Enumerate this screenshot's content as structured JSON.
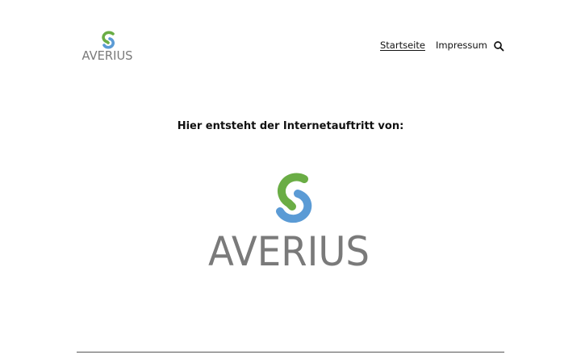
{
  "header": {
    "logo": {
      "wordmark": "AVERIUS",
      "icon": "averius-s-logo-icon"
    },
    "nav": [
      {
        "label": "Startseite",
        "current": true
      },
      {
        "label": "Impressum",
        "current": false
      }
    ],
    "search_icon": "search-icon"
  },
  "main": {
    "headline": "Hier entsteht der Internetauftritt von:",
    "hero_logo": {
      "wordmark": "AVERIUS",
      "icon": "averius-s-logo-icon"
    }
  },
  "colors": {
    "logo_green": "#6aad45",
    "logo_blue": "#5b9bd5",
    "wordmark_gray": "#7a7a7a",
    "text": "#111111",
    "divider": "#555555"
  }
}
